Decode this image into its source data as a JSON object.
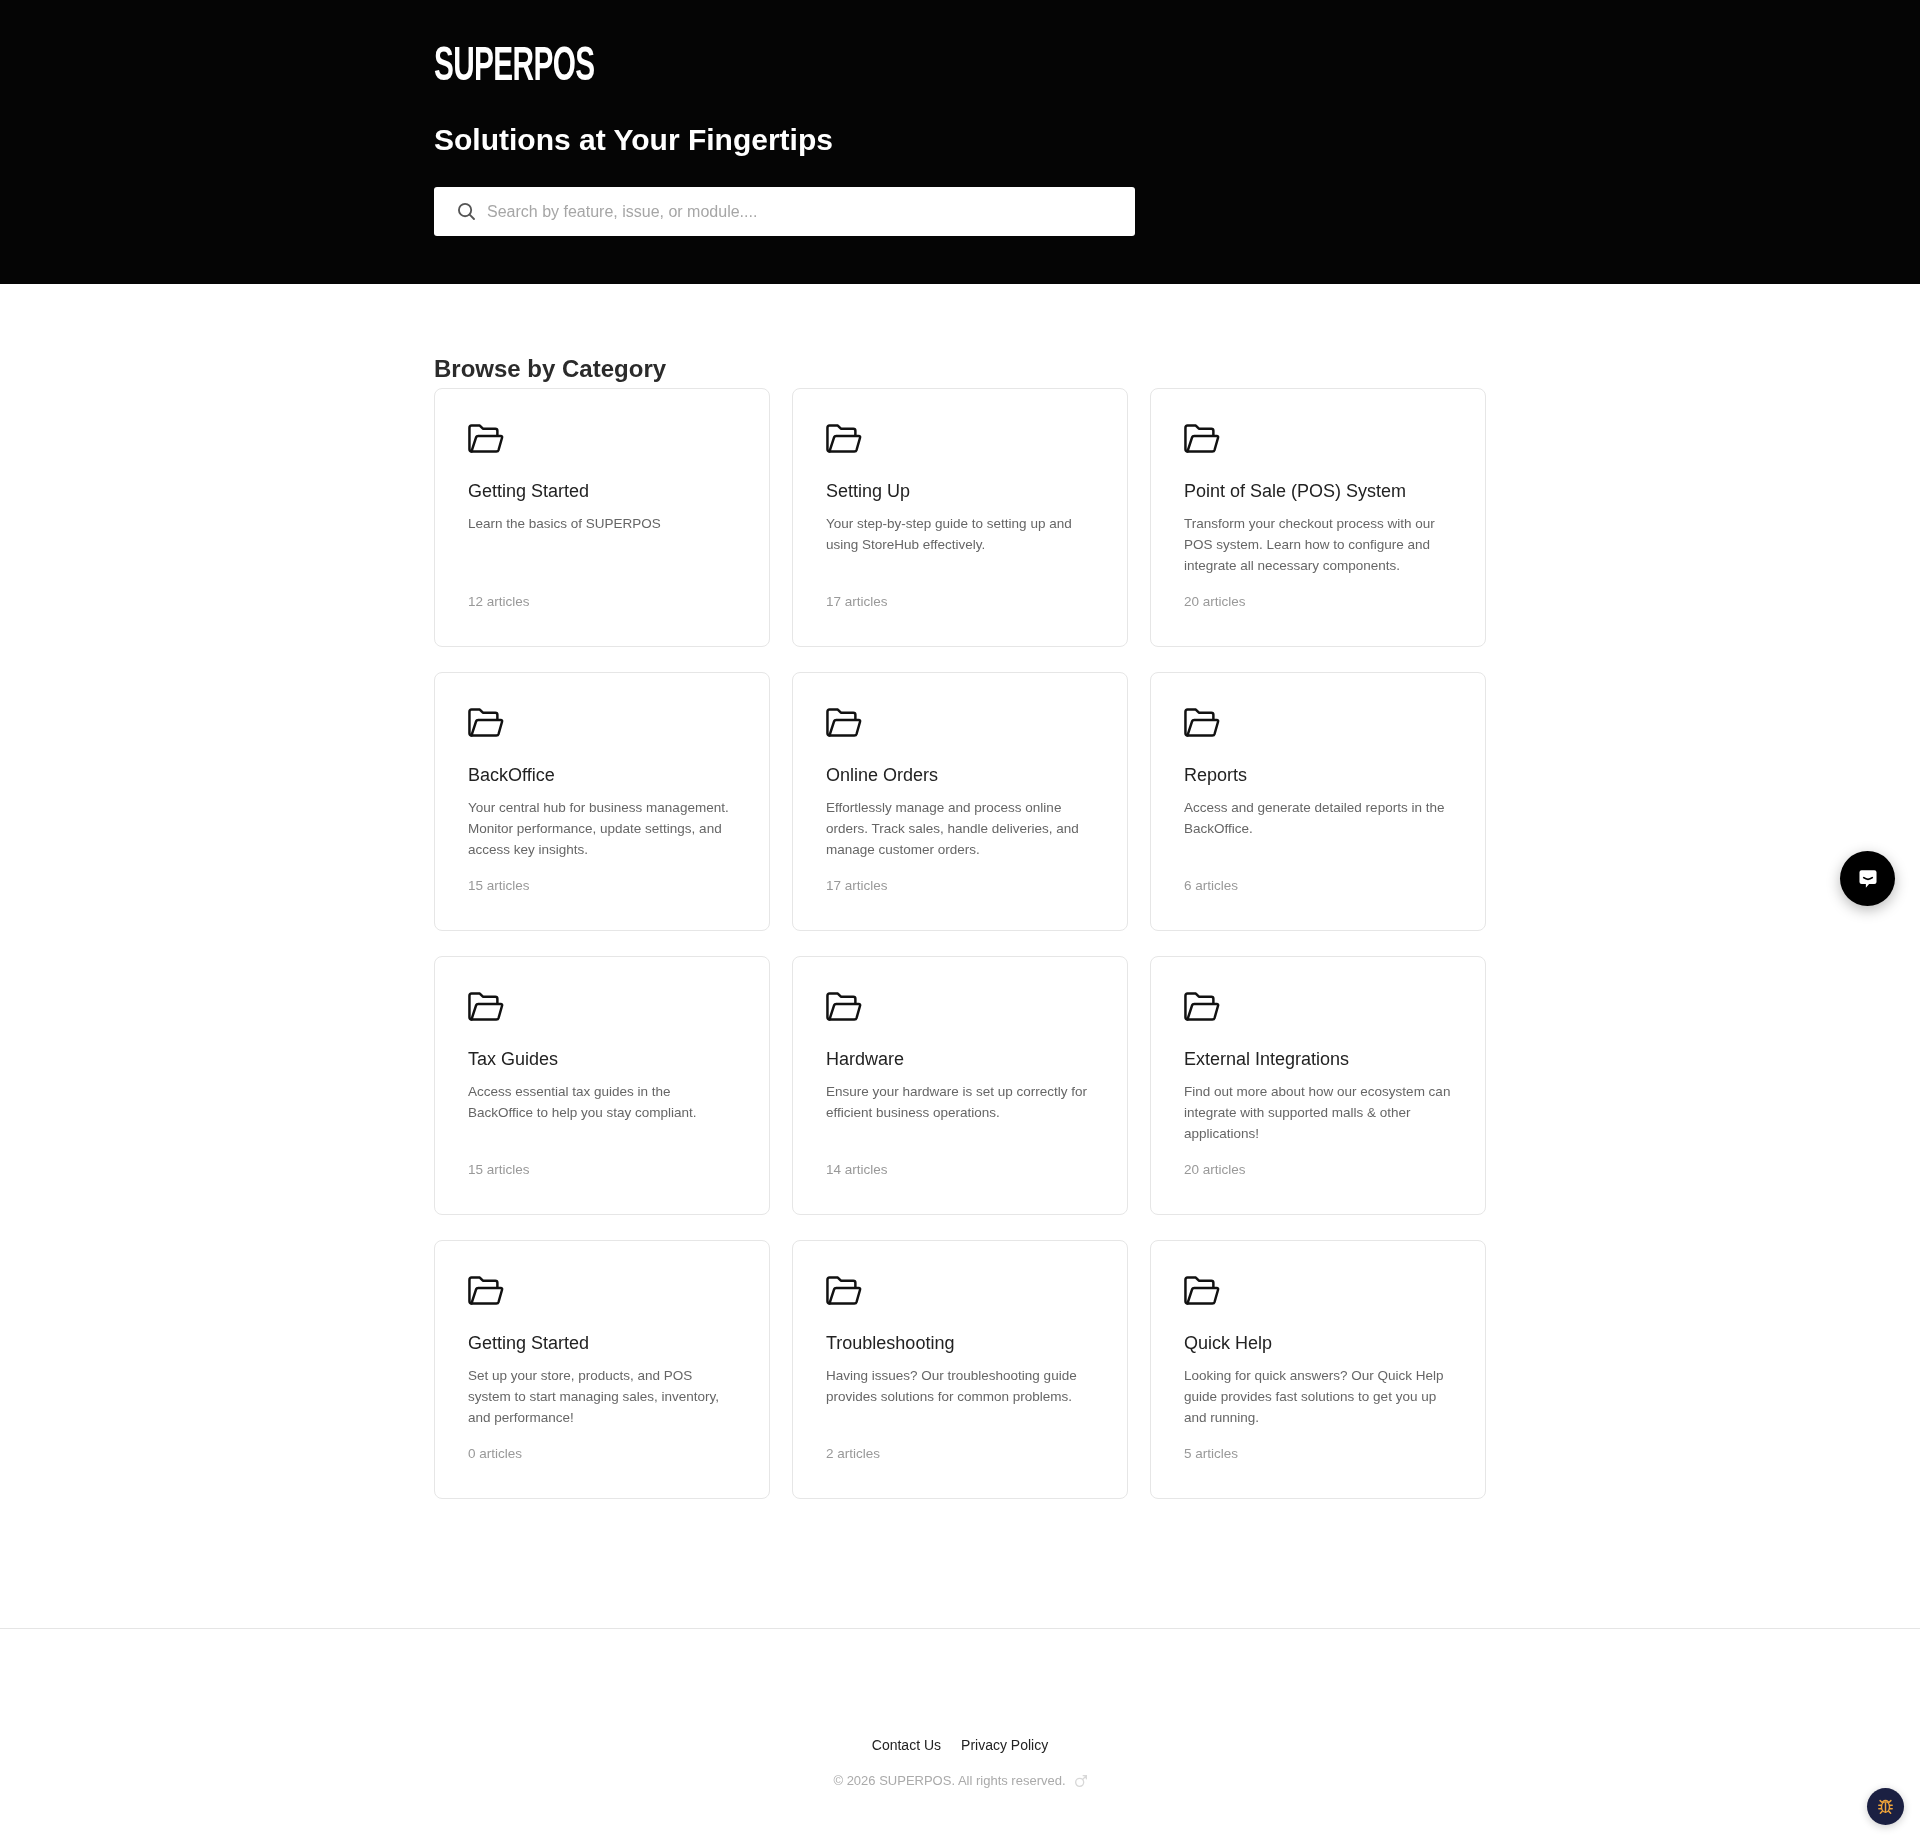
{
  "header": {
    "logo": "SUPERPOS",
    "title": "Solutions at Your Fingertips",
    "search": {
      "placeholder": "Search by feature, issue, or module...."
    }
  },
  "categories": {
    "heading": "Browse by Category",
    "cards": [
      {
        "title": "Getting Started",
        "description": "Learn the basics of SUPERPOS",
        "count": "12 articles"
      },
      {
        "title": "Setting Up",
        "description": "Your step-by-step guide to setting up and using StoreHub effectively.",
        "count": "17 articles"
      },
      {
        "title": "Point of Sale (POS) System",
        "description": "Transform your checkout process with our POS system. Learn how to configure and integrate all necessary components.",
        "count": "20 articles"
      },
      {
        "title": "BackOffice",
        "description": "Your central hub for business management. Monitor performance, update settings, and access key insights.",
        "count": "15 articles"
      },
      {
        "title": "Online Orders",
        "description": "Effortlessly manage and process online orders. Track sales, handle deliveries, and manage customer orders.",
        "count": "17 articles"
      },
      {
        "title": "Reports",
        "description": "Access and generate detailed reports in the BackOffice.",
        "count": "6 articles"
      },
      {
        "title": "Tax Guides",
        "description": "Access essential tax guides in the BackOffice to help you stay compliant.",
        "count": "15 articles"
      },
      {
        "title": "Hardware",
        "description": "Ensure your hardware is set up correctly for efficient business operations.",
        "count": "14 articles"
      },
      {
        "title": "External Integrations",
        "description": "Find out more about how our ecosystem can integrate with supported malls & other applications!",
        "count": "20 articles"
      },
      {
        "title": "Getting Started",
        "description": "Set up your store, products, and POS system to start managing sales, inventory, and performance!",
        "count": "0 articles"
      },
      {
        "title": "Troubleshooting",
        "description": "Having issues? Our troubleshooting guide provides solutions for common problems.",
        "count": "2 articles"
      },
      {
        "title": "Quick Help",
        "description": "Looking for quick answers? Our Quick Help guide provides fast solutions to get you up and running.",
        "count": "5 articles"
      }
    ]
  },
  "footer": {
    "links": [
      "Contact Us",
      "Privacy Policy"
    ],
    "copyright": "© 2026 SUPERPOS. All rights reserved."
  }
}
